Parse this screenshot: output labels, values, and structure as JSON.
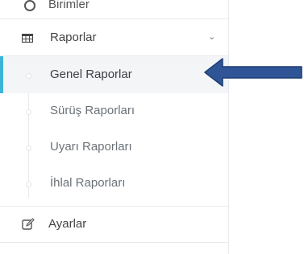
{
  "sidebar": {
    "top_item": {
      "label": "Birimler",
      "icon": "circle-icon"
    },
    "group": {
      "label": "Raporlar",
      "icon": "table-icon",
      "chevron": "chevron-down-icon",
      "expanded": true
    },
    "sub_items": [
      {
        "label": "Genel Raporlar",
        "active": true
      },
      {
        "label": "Sürüş Raporları",
        "active": false
      },
      {
        "label": "Uyarı Raporları",
        "active": false
      },
      {
        "label": "İhlal Raporları",
        "active": false
      }
    ],
    "bottom_item": {
      "label": "Ayarlar",
      "icon": "edit-icon"
    }
  },
  "annotation": {
    "icon": "arrow-left-icon",
    "color": "#2f5597"
  },
  "colors": {
    "active_bar": "#3cb3d8",
    "active_bg": "#f4f5f7",
    "border": "#e6e9ed"
  }
}
